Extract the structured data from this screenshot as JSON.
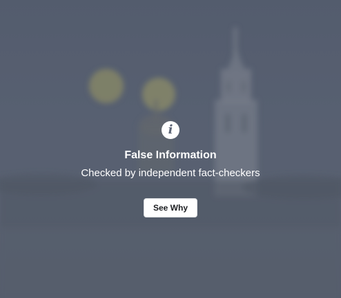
{
  "warning": {
    "icon": "info-icon",
    "icon_glyph": "i",
    "title": "False Information",
    "subtitle": "Checked by independent fact-checkers",
    "button_label": "See Why"
  },
  "colors": {
    "overlay": "#5f6777",
    "text": "#ffffff",
    "button_background": "#ffffff",
    "button_text": "#1c1e21"
  }
}
